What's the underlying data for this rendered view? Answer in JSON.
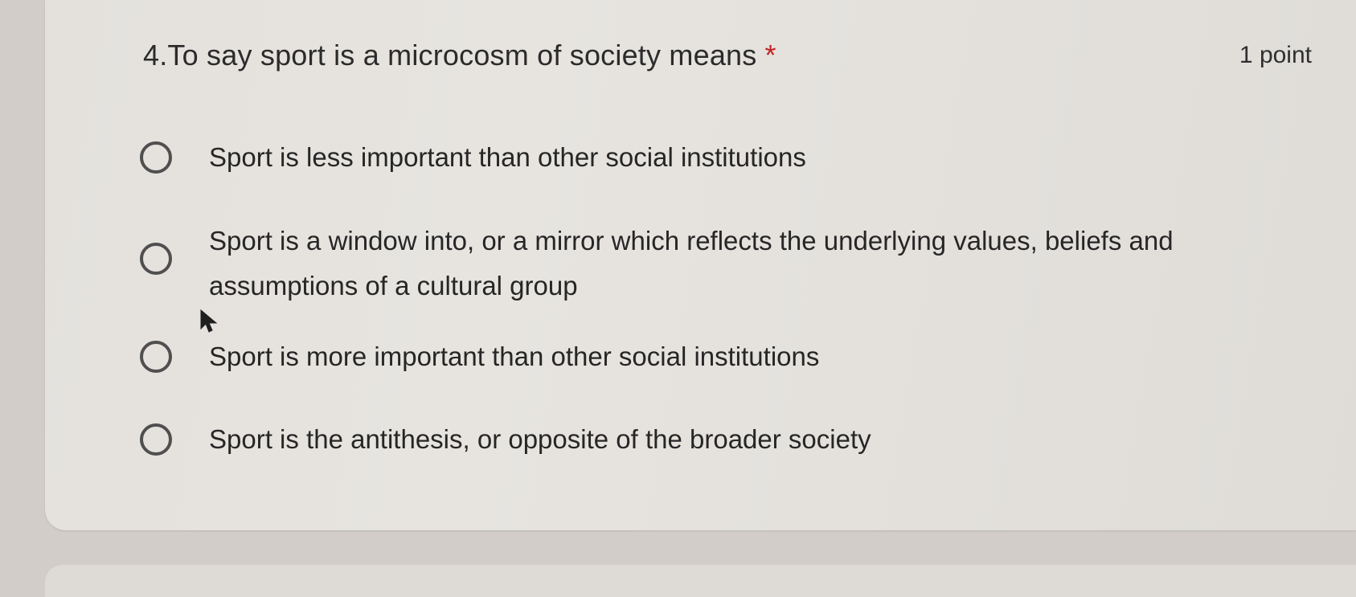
{
  "question": {
    "number_and_title": "4.To say sport is a microcosm of society means",
    "required_marker": "*",
    "points_label": "1 point"
  },
  "options": [
    {
      "label": "Sport is less important than other social institutions",
      "selected": false
    },
    {
      "label": "Sport is a window into, or a mirror which reflects the underlying values, beliefs and assumptions of a cultural group",
      "selected": false
    },
    {
      "label": "Sport is more important than other social institutions",
      "selected": false
    },
    {
      "label": "Sport is the antithesis, or opposite of the broader society",
      "selected": false
    }
  ],
  "colors": {
    "required_marker": "#c5221f",
    "radio_border": "#4f4f4f",
    "card_background": "#e5e2de"
  },
  "icons": {
    "cursor": "mouse-pointer-icon"
  }
}
